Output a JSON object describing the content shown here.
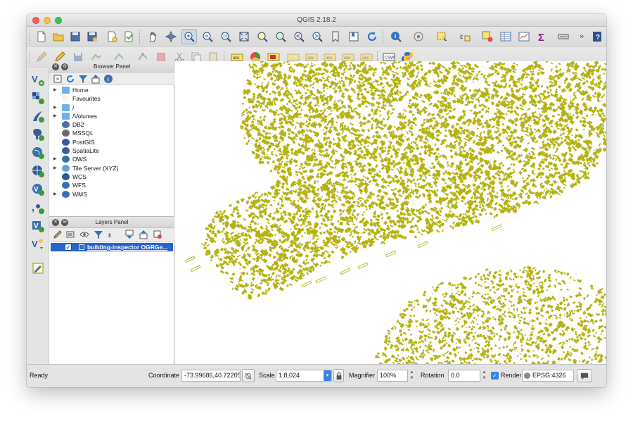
{
  "window": {
    "title": "QGIS 2.18.2"
  },
  "toolbar1": {
    "icons": [
      "new-project-icon",
      "open-project-icon",
      "save-project-icon",
      "save-as-icon",
      "new-print-composer-icon",
      "composer-manager-icon",
      "pan-icon",
      "pan-to-selection-icon",
      "zoom-in-icon",
      "zoom-out-icon",
      "zoom-native-icon",
      "zoom-full-icon",
      "zoom-to-selection-icon",
      "zoom-to-layer-icon",
      "zoom-last-icon",
      "zoom-next-icon",
      "new-bookmark-icon",
      "show-bookmarks-icon",
      "refresh-icon",
      "identify-icon",
      "measure-icon",
      "select-features-icon",
      "select-by-value-icon",
      "deselect-icon",
      "attribute-table-icon",
      "field-calculator-icon",
      "statistics-icon",
      "text-annotation-icon",
      "overflow-icon",
      "help-icon"
    ]
  },
  "toolbar2": {
    "icons": [
      "current-edits-icon",
      "toggle-editing-icon",
      "save-edits-icon",
      "add-feature-icon",
      "move-feature-icon",
      "node-tool-icon",
      "delete-selected-icon",
      "cut-features-icon",
      "copy-features-icon",
      "paste-features-icon",
      "label-tool-icon",
      "layer-labeling-icon",
      "pin-labels-icon",
      "show-hide-labels-icon",
      "move-label-icon",
      "rotate-label-icon",
      "change-label-icon",
      "csw-icon",
      "python-console-icon"
    ],
    "csw_label": "CSW"
  },
  "leftbar": {
    "icons": [
      "add-vector-layer-icon",
      "add-raster-layer-icon",
      "add-spatialite-icon",
      "add-postgis-icon",
      "add-wms-icon",
      "add-wcs-icon",
      "add-wfs-icon",
      "add-delimited-text-icon",
      "add-virtual-layer-icon",
      "new-shapefile-icon",
      "new-annotation-icon"
    ]
  },
  "browser_panel": {
    "title": "Browser Panel",
    "items": [
      {
        "label": "Home",
        "expandable": true,
        "icon": "folder-icon"
      },
      {
        "label": "Favourites",
        "expandable": false,
        "icon": "star-icon"
      },
      {
        "label": "/",
        "expandable": true,
        "icon": "folder-icon"
      },
      {
        "label": "/Volumes",
        "expandable": true,
        "icon": "folder-icon"
      },
      {
        "label": "DB2",
        "expandable": false,
        "icon": "db2-icon"
      },
      {
        "label": "MSSQL",
        "expandable": false,
        "icon": "mssql-icon"
      },
      {
        "label": "PostGIS",
        "expandable": false,
        "icon": "postgis-icon"
      },
      {
        "label": "SpatiaLite",
        "expandable": false,
        "icon": "spatialite-icon"
      },
      {
        "label": "OWS",
        "expandable": true,
        "icon": "ows-icon"
      },
      {
        "label": "Tile Server (XYZ)",
        "expandable": true,
        "icon": "globe-icon"
      },
      {
        "label": "WCS",
        "expandable": false,
        "icon": "wcs-icon"
      },
      {
        "label": "WFS",
        "expandable": false,
        "icon": "wfs-icon"
      },
      {
        "label": "WMS",
        "expandable": true,
        "icon": "wms-icon"
      }
    ]
  },
  "layers_panel": {
    "title": "Layers Panel",
    "layers": [
      {
        "label": "building-inspector OGRGe...",
        "checked": true
      }
    ]
  },
  "map": {
    "feature_color": "#b5b313"
  },
  "status": {
    "ready": "Ready",
    "coordinate_label": "Coordinate",
    "coordinate_value": "-73.99686,40.72205",
    "scale_label": "Scale",
    "scale_value": "1:8,024",
    "magnifier_label": "Magnifier",
    "magnifier_value": "100%",
    "rotation_label": "Rotation",
    "rotation_value": "0.0",
    "render_label": "Render",
    "render_checked": true,
    "crs_label": "EPSG:4326"
  }
}
